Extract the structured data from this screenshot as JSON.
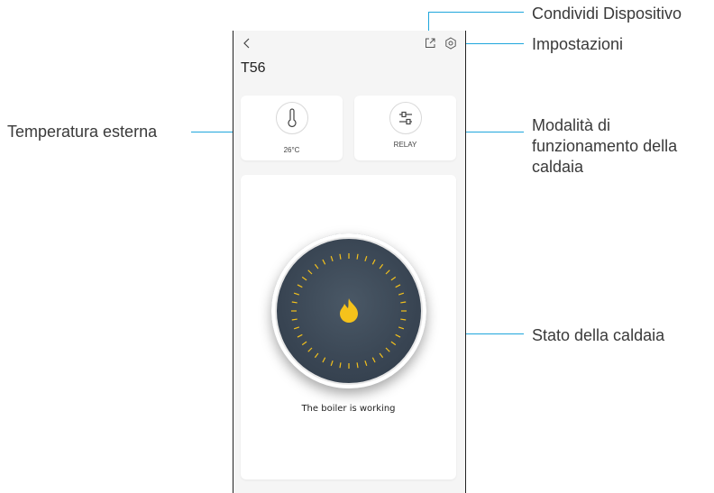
{
  "device": {
    "name": "T56",
    "outside_temperature": "26°C",
    "boiler_mode": "RELAY",
    "boiler_status": "The boiler is working"
  },
  "callouts": {
    "share_device": "Condividi Dispositivo",
    "settings": "Impostazioni",
    "outside_temp": "Temperatura esterna",
    "boiler_mode_1": "Modalità di",
    "boiler_mode_2": "funzionamento della",
    "boiler_mode_3": "caldaia",
    "boiler_state": "Stato della caldaia"
  },
  "icons": {
    "back": "chevron-left-icon",
    "share": "share-icon",
    "settings": "settings-icon",
    "thermometer": "thermometer-icon",
    "mode": "sliders-icon",
    "flame": "flame-icon"
  },
  "colors": {
    "callout_line": "#1fa6dc",
    "flame": "#f5c21b",
    "dial": "#384452"
  }
}
